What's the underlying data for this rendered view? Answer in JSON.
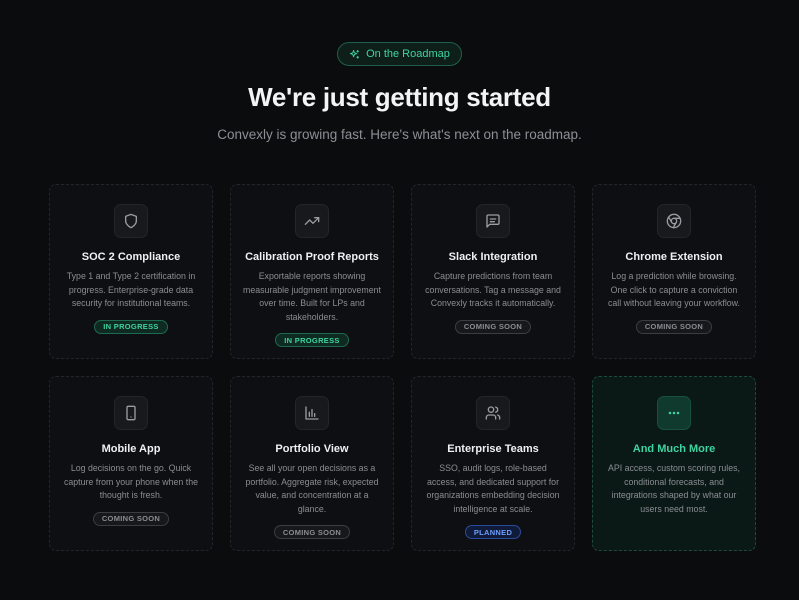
{
  "header": {
    "pill_label": "On the Roadmap",
    "title": "We're just getting started",
    "subtitle": "Convexly is growing fast. Here's what's next on the roadmap."
  },
  "cards": [
    {
      "title": "SOC 2 Compliance",
      "description": "Type 1 and Type 2 certification in progress. Enterprise-grade data security for institutional teams.",
      "badge": "IN PROGRESS",
      "icon": "shield-icon"
    },
    {
      "title": "Calibration Proof Reports",
      "description": "Exportable reports showing measurable judgment improvement over time. Built for LPs and stakeholders.",
      "badge": "IN PROGRESS",
      "icon": "trending-up-icon"
    },
    {
      "title": "Slack Integration",
      "description": "Capture predictions from team conversations. Tag a message and Convexly tracks it automatically.",
      "badge": "COMING SOON",
      "icon": "message-icon"
    },
    {
      "title": "Chrome Extension",
      "description": "Log a prediction while browsing. One click to capture a conviction call without leaving your workflow.",
      "badge": "COMING SOON",
      "icon": "chrome-icon"
    },
    {
      "title": "Mobile App",
      "description": "Log decisions on the go. Quick capture from your phone when the thought is fresh.",
      "badge": "COMING SOON",
      "icon": "smartphone-icon"
    },
    {
      "title": "Portfolio View",
      "description": "See all your open decisions as a portfolio. Aggregate risk, expected value, and concentration at a glance.",
      "badge": "COMING SOON",
      "icon": "bar-chart-icon"
    },
    {
      "title": "Enterprise Teams",
      "description": "SSO, audit logs, role-based access, and dedicated support for organizations embedding decision intelligence at scale.",
      "badge": "PLANNED",
      "icon": "users-icon"
    },
    {
      "title": "And Much More",
      "description": "API access, custom scoring rules, conditional forecasts, and integrations shaped by what our users need most.",
      "badge": "",
      "icon": "ellipsis-icon"
    }
  ],
  "colors": {
    "accent": "#3ed4a0",
    "background": "#0b0c0e",
    "card": "#0e0f12",
    "planned": "#6d9dff"
  }
}
